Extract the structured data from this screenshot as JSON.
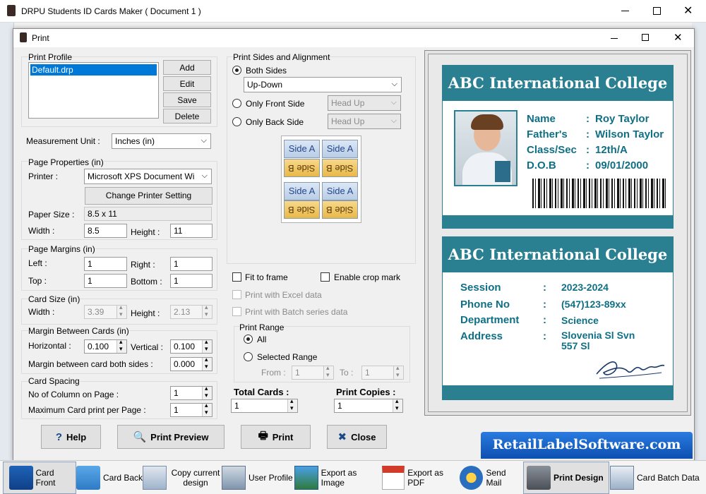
{
  "app": {
    "title": "DRPU Students ID Cards Maker ( Document 1 )"
  },
  "dialog": {
    "title": "Print"
  },
  "print_profile": {
    "legend": "Print Profile",
    "items": [
      "Default.drp"
    ],
    "add": "Add",
    "edit": "Edit",
    "save": "Save",
    "delete": "Delete"
  },
  "measurement": {
    "label": "Measurement Unit :",
    "value": "Inches (in)"
  },
  "page_properties": {
    "legend": "Page Properties (in)",
    "printer_label": "Printer :",
    "printer_value": "Microsoft XPS Document Wi",
    "change_printer": "Change Printer Setting",
    "paper_size_label": "Paper Size :",
    "paper_size_value": "8.5 x 11",
    "width_label": "Width :",
    "width_value": "8.5",
    "height_label": "Height :",
    "height_value": "11"
  },
  "page_margins": {
    "legend": "Page Margins (in)",
    "left_label": "Left :",
    "left_value": "1",
    "right_label": "Right :",
    "right_value": "1",
    "top_label": "Top :",
    "top_value": "1",
    "bottom_label": "Bottom :",
    "bottom_value": "1"
  },
  "card_size": {
    "legend": "Card Size (in)",
    "width_label": "Width :",
    "width_value": "3.39",
    "height_label": "Height :",
    "height_value": "2.13"
  },
  "margin_between": {
    "legend": "Margin Between Cards (in)",
    "horizontal_label": "Horizontal :",
    "horizontal_value": "0.100",
    "vertical_label": "Vertical :",
    "vertical_value": "0.100",
    "both_sides_label": "Margin between card both sides :",
    "both_sides_value": "0.000"
  },
  "card_spacing": {
    "legend": "Card Spacing",
    "columns_label": "No of Column on Page :",
    "columns_value": "1",
    "max_label": "Maximum Card print per Page :",
    "max_value": "1"
  },
  "print_sides": {
    "legend": "Print Sides and Alignment",
    "both_sides": "Both Sides",
    "both_value": "Up-Down",
    "front_only": "Only Front Side",
    "front_value": "Head Up",
    "back_only": "Only Back Side",
    "back_value": "Head Up",
    "side_a": "Side A",
    "side_b": "Side B"
  },
  "options": {
    "fit_to_frame": "Fit to frame",
    "crop_mark": "Enable crop mark",
    "excel": "Print with Excel data",
    "batch": "Print with Batch series data"
  },
  "print_range": {
    "legend": "Print Range",
    "all": "All",
    "selected": "Selected Range",
    "from_label": "From :",
    "from_value": "1",
    "to_label": "To :",
    "to_value": "1"
  },
  "totals": {
    "total_label": "Total Cards :",
    "total_value": "1",
    "copies_label": "Print Copies :",
    "copies_value": "1"
  },
  "buttons": {
    "help": "Help",
    "preview": "Print Preview",
    "print": "Print",
    "close": "Close"
  },
  "front_card": {
    "title": "ABC International College",
    "fields": [
      {
        "label": "Name",
        "value": "Roy Taylor"
      },
      {
        "label": "Father's",
        "value": "Wilson Taylor"
      },
      {
        "label": "Class/Sec",
        "value": "12th/A"
      },
      {
        "label": "D.O.B",
        "value": "09/01/2000"
      }
    ]
  },
  "back_card": {
    "title": "ABC International College",
    "fields": [
      {
        "label": "Session",
        "value": "2023-2024"
      },
      {
        "label": "Phone No",
        "value": "(547)123-89xx"
      },
      {
        "label": "Department",
        "value": "Science"
      },
      {
        "label": "Address",
        "value": "Slovenia Sl Svn\n557 Sl"
      }
    ]
  },
  "brand": {
    "text": "RetailLabelSoftware.com"
  },
  "toolbar": {
    "items": [
      "Card Front",
      "Card Back",
      "Copy current design",
      "User Profile",
      "Export as Image",
      "Export as PDF",
      "Send Mail",
      "Print Design",
      "Card Batch Data"
    ]
  },
  "colors": {
    "teal": "#2a8090",
    "brand_bg": "#1560c8"
  }
}
